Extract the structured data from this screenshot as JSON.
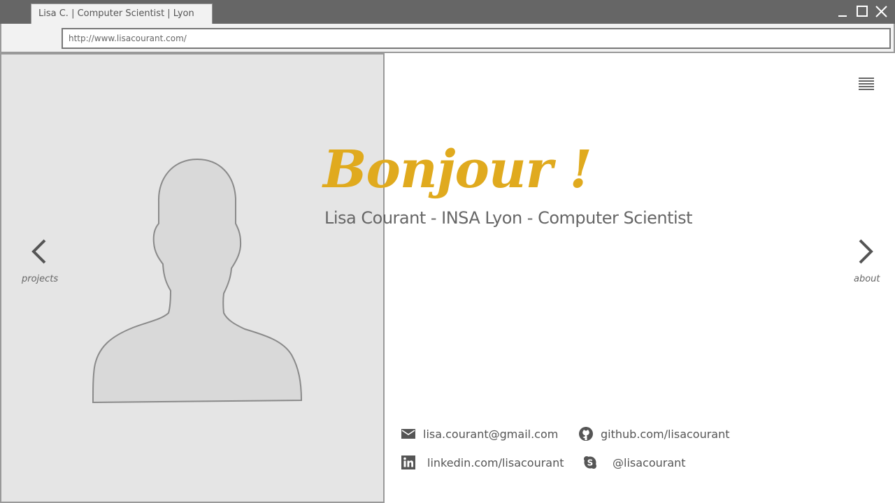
{
  "browser": {
    "tab_title": "Lisa C. | Computer Scientist | Lyon",
    "url": "http://www.lisacourant.com/"
  },
  "nav": {
    "left_label": "projects",
    "right_label": "about"
  },
  "hero": {
    "greeting": "Bonjour !",
    "subtitle": "Lisa Courant - INSA Lyon - Computer Scientist"
  },
  "contacts": {
    "email": "lisa.courant@gmail.com",
    "github": "github.com/lisacourant",
    "linkedin": "linkedin.com/lisacourant",
    "skype": "@lisacourant"
  },
  "colors": {
    "accent": "#e0aa1e",
    "chrome": "#666666",
    "panel": "#e5e5e5"
  }
}
